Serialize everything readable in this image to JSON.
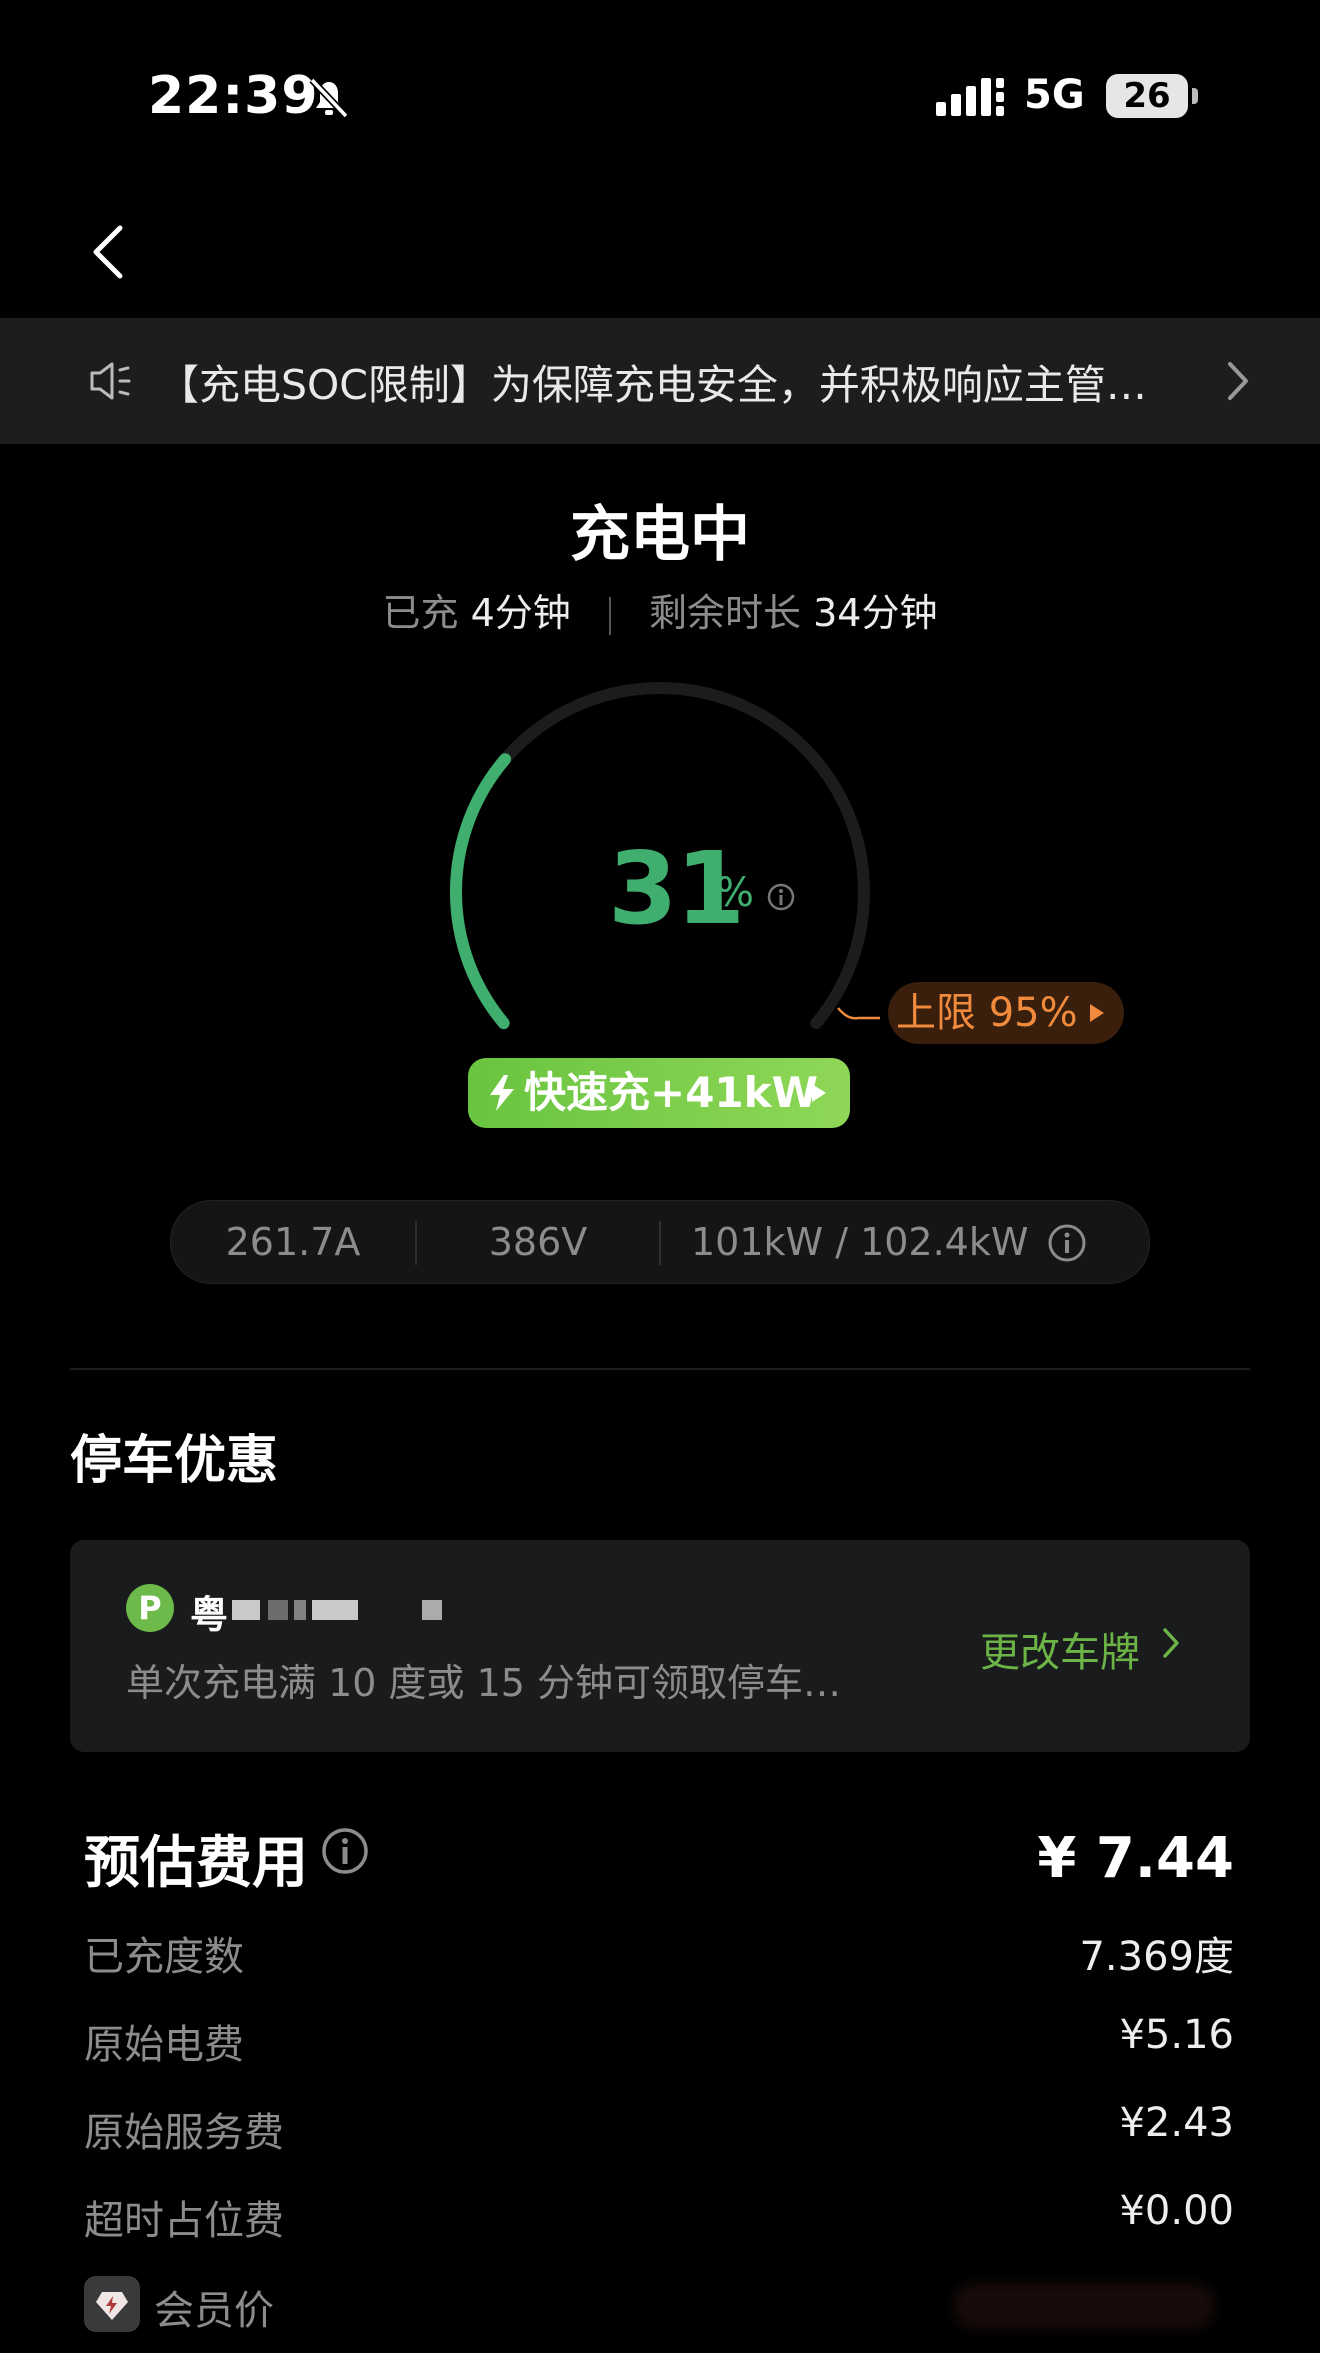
{
  "status_bar": {
    "time": "22:39",
    "network": "5G",
    "battery": "26"
  },
  "notice": {
    "text": "【充电SOC限制】为保障充电安全，并积极响应主管…"
  },
  "charging": {
    "title": "充电中",
    "charged_label": "已充",
    "charged_value": "4分钟",
    "remaining_label": "剩余时长",
    "remaining_value": "34分钟",
    "percent": "31",
    "percent_sign": "%",
    "soc_fraction": 0.31,
    "limit": "上限 95%",
    "fast_charge": "快速充+41kW"
  },
  "stats": {
    "current": "261.7A",
    "voltage": "386V",
    "power": "101kW / 102.4kW"
  },
  "parking": {
    "section_title": "停车优惠",
    "p_badge": "P",
    "plate_prefix": "粤",
    "description": "单次充电满 10 度或 15 分钟可领取停车…",
    "change_plate": "更改车牌"
  },
  "fees": {
    "title": "预估费用",
    "total": "¥ 7.44",
    "rows": [
      {
        "label": "已充度数",
        "value": "7.369度"
      },
      {
        "label": "原始电费",
        "value": "¥5.16"
      },
      {
        "label": "原始服务费",
        "value": "¥2.43"
      },
      {
        "label": "超时占位费",
        "value": "¥0.00"
      }
    ],
    "member_label": "会员价"
  },
  "colors": {
    "accent_green": "#3fae6e",
    "limit_orange": "#f08a3c",
    "fast_green": "#7acd4b"
  }
}
